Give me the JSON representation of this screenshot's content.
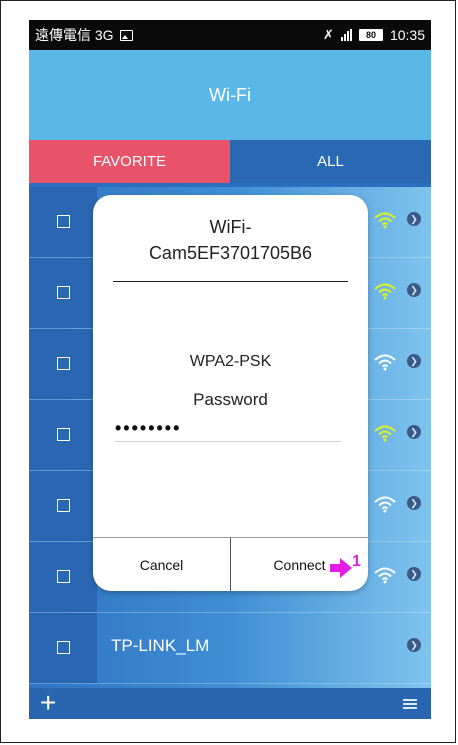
{
  "status_bar": {
    "carrier": "遠傳電信 3G",
    "battery": "80",
    "time": "10:35"
  },
  "header": {
    "title": "Wi-Fi"
  },
  "tabs": [
    {
      "label": "FAVORITE",
      "active": true,
      "color": "#e9536a"
    },
    {
      "label": "ALL",
      "active": false,
      "color": "#2b68b3"
    }
  ],
  "networks": [
    {
      "ssid": "",
      "signal": "strong",
      "wifi_color": "#dff21a"
    },
    {
      "ssid": "",
      "signal": "strong",
      "wifi_color": "#dff21a"
    },
    {
      "ssid": "",
      "signal": "medium",
      "wifi_color": "#ffffff"
    },
    {
      "ssid": "",
      "signal": "strong",
      "wifi_color": "#dff21a"
    },
    {
      "ssid": "",
      "signal": "medium",
      "wifi_color": "#ffffff"
    },
    {
      "ssid": "",
      "signal": "medium",
      "wifi_color": "#ffffff"
    },
    {
      "ssid": "TP-LINK_LM",
      "signal": "none",
      "wifi_color": ""
    }
  ],
  "dialog": {
    "title_line1": "WiFi-",
    "title_line2": "Cam5EF3701705B6",
    "security": "WPA2-PSK",
    "password_label": "Password",
    "password_value": "••••••••",
    "cancel_label": "Cancel",
    "connect_label": "Connect"
  },
  "annotation": {
    "label": "1",
    "color": "#e21de8"
  },
  "icons": {
    "add": "plus-icon",
    "menu": "menu-icon",
    "row_arrow": "chevron-right-icon",
    "signal": "wifi-signal-icon"
  }
}
